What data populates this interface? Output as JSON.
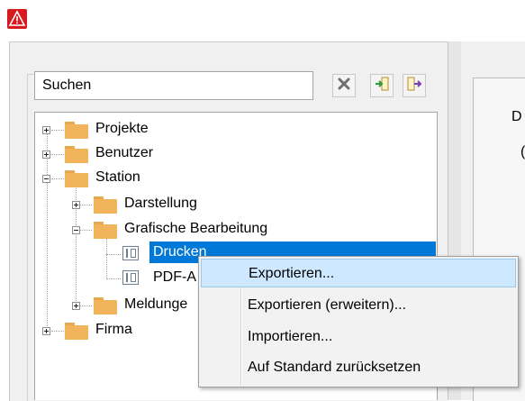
{
  "app": {
    "icon": "warning-triangle-icon",
    "brand_color": "#d71920"
  },
  "search": {
    "placeholder": "Suchen",
    "value": ""
  },
  "toolbar": {
    "clear_icon": "clear-x-icon",
    "import_icon": "import-arrow-icon",
    "export_icon": "export-arrow-icon"
  },
  "tree": {
    "items": [
      {
        "label": "Projekte",
        "expanded": false,
        "icon": "folder-icon"
      },
      {
        "label": "Benutzer",
        "expanded": false,
        "icon": "folder-icon"
      },
      {
        "label": "Station",
        "expanded": true,
        "icon": "folder-icon"
      },
      {
        "label": "Darstellung",
        "expanded": false,
        "icon": "folder-icon"
      },
      {
        "label": "Grafische Bearbeitung",
        "expanded": true,
        "icon": "folder-icon"
      },
      {
        "label": "Drucken",
        "selected": true,
        "icon": "document-icon"
      },
      {
        "label": "PDF-A",
        "icon": "document-icon"
      },
      {
        "label": "Meldunge",
        "expanded": false,
        "icon": "folder-icon"
      },
      {
        "label": "Firma",
        "expanded": false,
        "icon": "folder-icon"
      }
    ]
  },
  "context_menu": {
    "items": [
      {
        "label": "Exportieren...",
        "highlighted": true
      },
      {
        "label": "Exportieren (erweitern)..."
      },
      {
        "label": "Importieren..."
      },
      {
        "label": "Auf Standard zurücksetzen"
      }
    ]
  },
  "right_panel": {
    "group_label": "D",
    "stub_text": "("
  },
  "colors": {
    "selection": "#0078d7",
    "menu_highlight": "#cde8ff",
    "folder": "#f2b45a"
  }
}
